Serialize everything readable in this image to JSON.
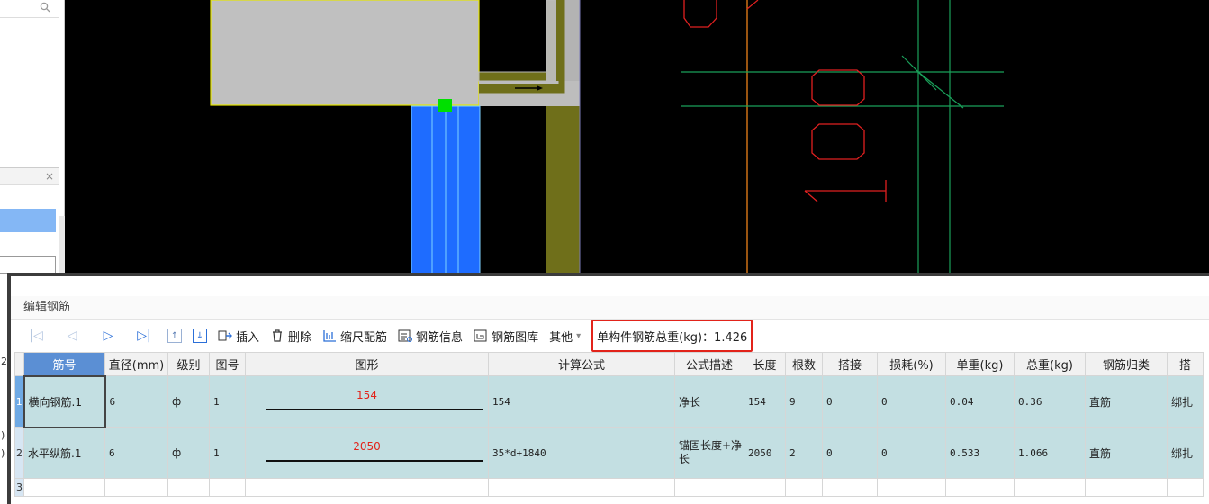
{
  "left_panel": {
    "search_icon": "search-icon",
    "close_glyph": "×"
  },
  "under_strip": {
    "labels": [
      "2",
      ")",
      ")"
    ]
  },
  "dialog": {
    "title": "编辑钢筋",
    "toolbar": {
      "first": "|◁",
      "prev": "◁",
      "next": "▷",
      "last": "▷|",
      "up": "↑",
      "down": "↓",
      "insert": "插入",
      "delete": "删除",
      "scale": "缩尺配筋",
      "info": "钢筋信息",
      "library": "钢筋图库",
      "other": "其他",
      "other_arrow": "▾",
      "total_weight": "单构件钢筋总重(kg)：1.426"
    },
    "columns": [
      "筋号",
      "直径(mm)",
      "级别",
      "图号",
      "图形",
      "计算公式",
      "公式描述",
      "长度",
      "根数",
      "搭接",
      "损耗(%)",
      "单重(kg)",
      "总重(kg)",
      "钢筋归类",
      "搭"
    ],
    "rows": [
      {
        "num": "1",
        "name": "横向钢筋.1",
        "diameter": "6",
        "grade": "ф",
        "fig": "1",
        "shape_value": "154",
        "formula": "154",
        "desc": "净长",
        "length": "154",
        "count": "9",
        "lap": "0",
        "loss": "0",
        "unit_weight": "0.04",
        "total_weight": "0.36",
        "category": "直筋",
        "tie": "绑扎"
      },
      {
        "num": "2",
        "name": "水平纵筋.1",
        "diameter": "6",
        "grade": "ф",
        "fig": "1",
        "shape_value": "2050",
        "formula": "35*d+1840",
        "desc": "锚固长度+净长",
        "length": "2050",
        "count": "2",
        "lap": "0",
        "loss": "0",
        "unit_weight": "0.533",
        "total_weight": "1.066",
        "category": "直筋",
        "tie": "绑扎"
      }
    ],
    "empty_row_num": "3"
  },
  "colors": {
    "selection_blue": "#5b8fd4",
    "row_teal": "#c3dfe2",
    "highlight_red": "#e2231a",
    "cad_background": "#000000"
  }
}
